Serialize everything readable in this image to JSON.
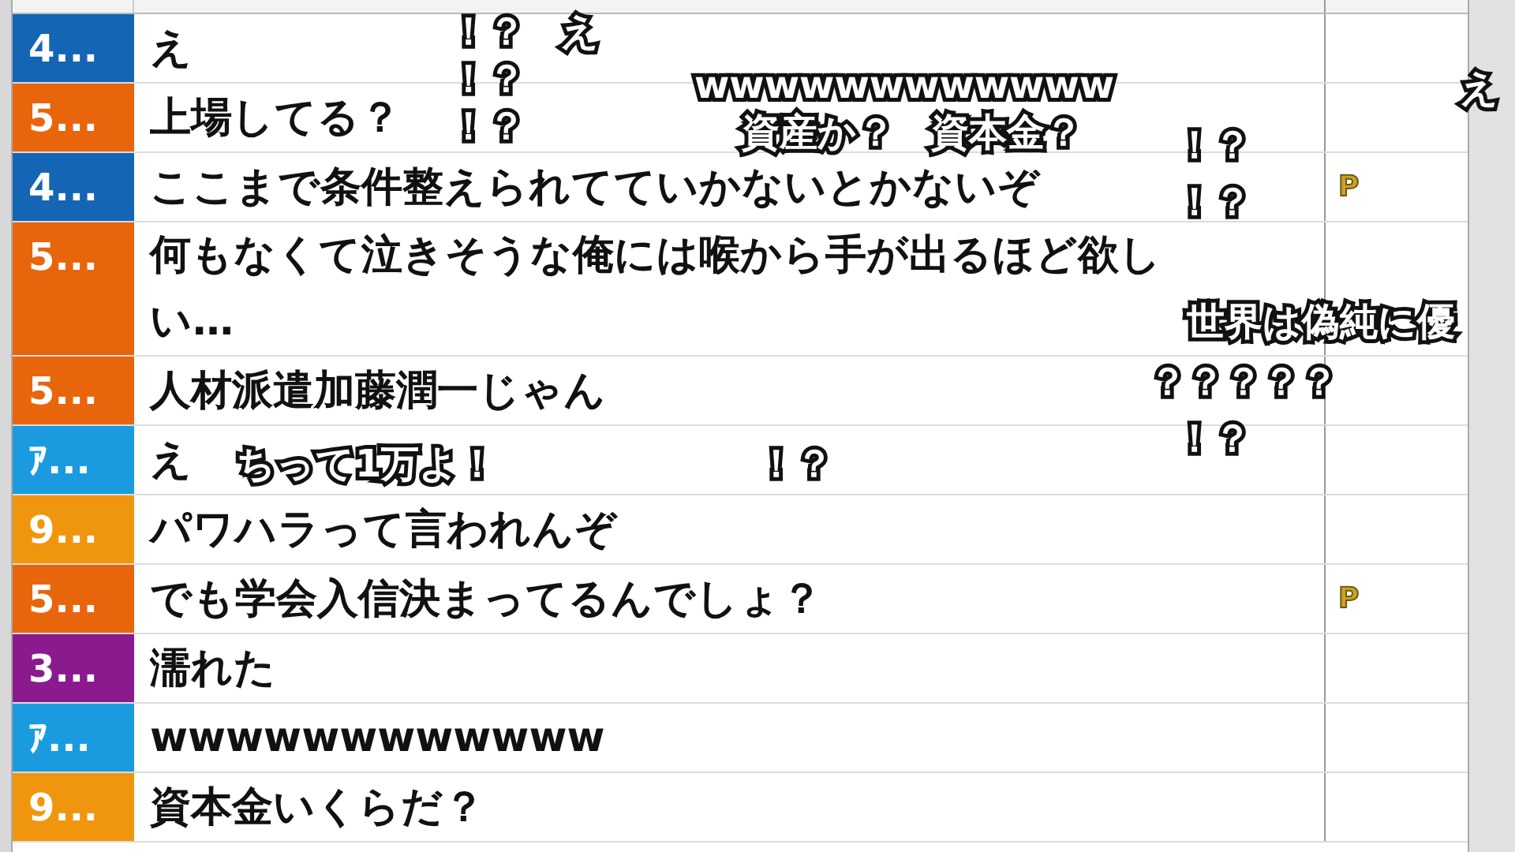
{
  "comments": [
    {
      "number": "4...",
      "color": "#1565b5",
      "text": "え"
    },
    {
      "number": "5...",
      "color": "#e8650c",
      "text": "上場してる？"
    },
    {
      "number": "4...",
      "color": "#1565b5",
      "text": "ここまで条件整えられてていかないとかないぞ",
      "info": "P"
    },
    {
      "number": "5...",
      "color": "#e8650c",
      "text": "何もなくて泣きそうな俺には喉から手が出るほど欲しい…"
    },
    {
      "number": "5...",
      "color": "#e8650c",
      "text": "人材派遣加藤潤一じゃん"
    },
    {
      "number": "ｱ...",
      "color": "#1a9be0",
      "text": "え"
    },
    {
      "number": "9...",
      "color": "#f0960e",
      "text": "パワハラって言われんぞ"
    },
    {
      "number": "5...",
      "color": "#e8650c",
      "text": "でも学会入信決まってるんでしょ？",
      "info": "P"
    },
    {
      "number": "3...",
      "color": "#8b1a8e",
      "text": "濡れた"
    },
    {
      "number": "ｱ...",
      "color": "#1a9be0",
      "text": "wwwwwwwwwwww"
    },
    {
      "number": "9...",
      "color": "#f0960e",
      "text": "資本金いくらだ？"
    }
  ],
  "flowing_comments": [
    {
      "text": "！？"
    },
    {
      "text": "！？"
    },
    {
      "text": "！？"
    },
    {
      "text": "え"
    },
    {
      "text": "wwwwwwwwwwww"
    },
    {
      "text": "資産か？"
    },
    {
      "text": "資本金？"
    },
    {
      "text": "！？"
    },
    {
      "text": "！？"
    },
    {
      "text": "ちって1万よ！"
    },
    {
      "text": "！？"
    },
    {
      "text": "世界は偽純に優"
    },
    {
      "text": "？？？？？"
    },
    {
      "text": "！？"
    },
    {
      "text": "え"
    }
  ]
}
